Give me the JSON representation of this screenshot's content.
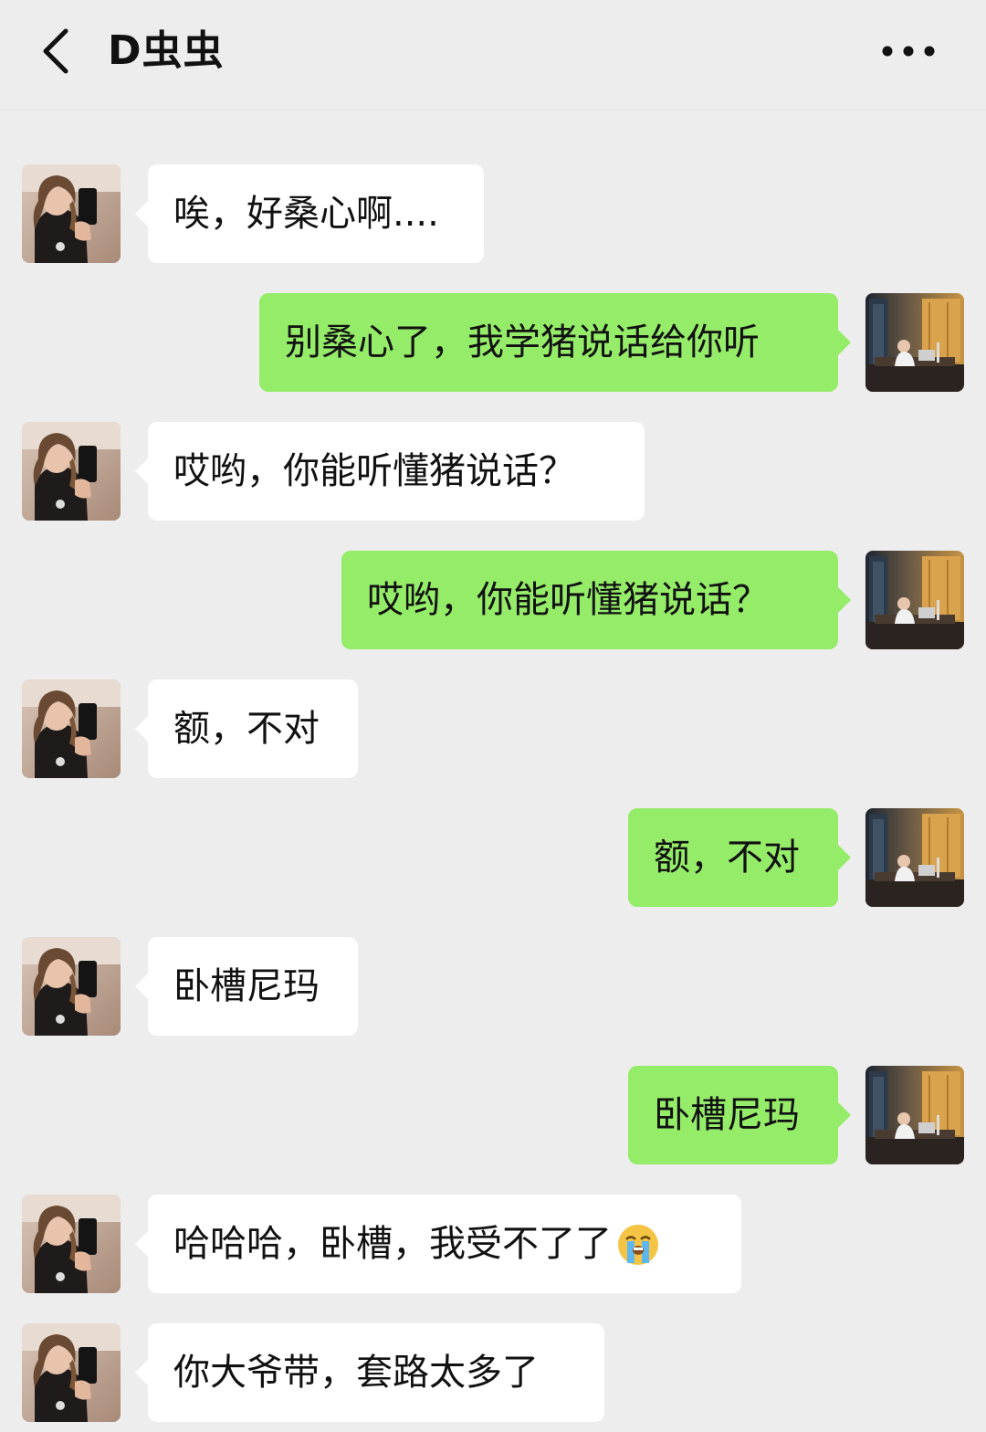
{
  "header": {
    "title": "D虫虫",
    "back_icon": "chevron-left-icon",
    "more_icon": "more-dots-icon"
  },
  "colors": {
    "background": "#ededed",
    "sent_bubble": "#95ec69",
    "received_bubble": "#ffffff"
  },
  "messages": [
    {
      "from": "other",
      "text": "唉，好桑心啊...."
    },
    {
      "from": "me",
      "text": "别桑心了，我学猪说话给你听"
    },
    {
      "from": "other",
      "text": "哎哟，你能听懂猪说话？"
    },
    {
      "from": "me",
      "text": "哎哟，你能听懂猪说话？"
    },
    {
      "from": "other",
      "text": "额，不对"
    },
    {
      "from": "me",
      "text": "额，不对"
    },
    {
      "from": "other",
      "text": "卧槽尼玛"
    },
    {
      "from": "me",
      "text": "卧槽尼玛"
    },
    {
      "from": "other",
      "text": "哈哈哈，卧槽，我受不了了",
      "emoji": "crying-face-emoji"
    },
    {
      "from": "other",
      "text": "你大爷带，套路太多了"
    }
  ]
}
